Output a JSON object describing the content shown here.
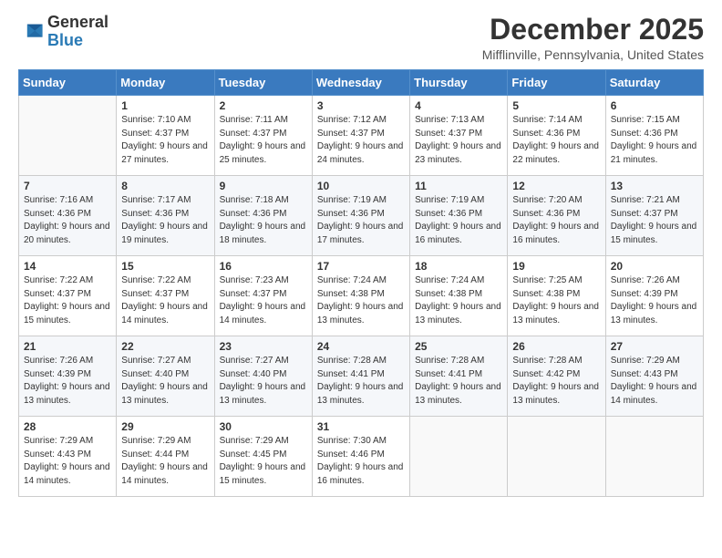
{
  "header": {
    "logo": {
      "line1": "General",
      "line2": "Blue"
    },
    "title": "December 2025",
    "location": "Mifflinville, Pennsylvania, United States"
  },
  "days_of_week": [
    "Sunday",
    "Monday",
    "Tuesday",
    "Wednesday",
    "Thursday",
    "Friday",
    "Saturday"
  ],
  "weeks": [
    [
      {
        "day": "",
        "sunrise": "",
        "sunset": "",
        "daylight": ""
      },
      {
        "day": "1",
        "sunrise": "Sunrise: 7:10 AM",
        "sunset": "Sunset: 4:37 PM",
        "daylight": "Daylight: 9 hours and 27 minutes."
      },
      {
        "day": "2",
        "sunrise": "Sunrise: 7:11 AM",
        "sunset": "Sunset: 4:37 PM",
        "daylight": "Daylight: 9 hours and 25 minutes."
      },
      {
        "day": "3",
        "sunrise": "Sunrise: 7:12 AM",
        "sunset": "Sunset: 4:37 PM",
        "daylight": "Daylight: 9 hours and 24 minutes."
      },
      {
        "day": "4",
        "sunrise": "Sunrise: 7:13 AM",
        "sunset": "Sunset: 4:37 PM",
        "daylight": "Daylight: 9 hours and 23 minutes."
      },
      {
        "day": "5",
        "sunrise": "Sunrise: 7:14 AM",
        "sunset": "Sunset: 4:36 PM",
        "daylight": "Daylight: 9 hours and 22 minutes."
      },
      {
        "day": "6",
        "sunrise": "Sunrise: 7:15 AM",
        "sunset": "Sunset: 4:36 PM",
        "daylight": "Daylight: 9 hours and 21 minutes."
      }
    ],
    [
      {
        "day": "7",
        "sunrise": "Sunrise: 7:16 AM",
        "sunset": "Sunset: 4:36 PM",
        "daylight": "Daylight: 9 hours and 20 minutes."
      },
      {
        "day": "8",
        "sunrise": "Sunrise: 7:17 AM",
        "sunset": "Sunset: 4:36 PM",
        "daylight": "Daylight: 9 hours and 19 minutes."
      },
      {
        "day": "9",
        "sunrise": "Sunrise: 7:18 AM",
        "sunset": "Sunset: 4:36 PM",
        "daylight": "Daylight: 9 hours and 18 minutes."
      },
      {
        "day": "10",
        "sunrise": "Sunrise: 7:19 AM",
        "sunset": "Sunset: 4:36 PM",
        "daylight": "Daylight: 9 hours and 17 minutes."
      },
      {
        "day": "11",
        "sunrise": "Sunrise: 7:19 AM",
        "sunset": "Sunset: 4:36 PM",
        "daylight": "Daylight: 9 hours and 16 minutes."
      },
      {
        "day": "12",
        "sunrise": "Sunrise: 7:20 AM",
        "sunset": "Sunset: 4:36 PM",
        "daylight": "Daylight: 9 hours and 16 minutes."
      },
      {
        "day": "13",
        "sunrise": "Sunrise: 7:21 AM",
        "sunset": "Sunset: 4:37 PM",
        "daylight": "Daylight: 9 hours and 15 minutes."
      }
    ],
    [
      {
        "day": "14",
        "sunrise": "Sunrise: 7:22 AM",
        "sunset": "Sunset: 4:37 PM",
        "daylight": "Daylight: 9 hours and 15 minutes."
      },
      {
        "day": "15",
        "sunrise": "Sunrise: 7:22 AM",
        "sunset": "Sunset: 4:37 PM",
        "daylight": "Daylight: 9 hours and 14 minutes."
      },
      {
        "day": "16",
        "sunrise": "Sunrise: 7:23 AM",
        "sunset": "Sunset: 4:37 PM",
        "daylight": "Daylight: 9 hours and 14 minutes."
      },
      {
        "day": "17",
        "sunrise": "Sunrise: 7:24 AM",
        "sunset": "Sunset: 4:38 PM",
        "daylight": "Daylight: 9 hours and 13 minutes."
      },
      {
        "day": "18",
        "sunrise": "Sunrise: 7:24 AM",
        "sunset": "Sunset: 4:38 PM",
        "daylight": "Daylight: 9 hours and 13 minutes."
      },
      {
        "day": "19",
        "sunrise": "Sunrise: 7:25 AM",
        "sunset": "Sunset: 4:38 PM",
        "daylight": "Daylight: 9 hours and 13 minutes."
      },
      {
        "day": "20",
        "sunrise": "Sunrise: 7:26 AM",
        "sunset": "Sunset: 4:39 PM",
        "daylight": "Daylight: 9 hours and 13 minutes."
      }
    ],
    [
      {
        "day": "21",
        "sunrise": "Sunrise: 7:26 AM",
        "sunset": "Sunset: 4:39 PM",
        "daylight": "Daylight: 9 hours and 13 minutes."
      },
      {
        "day": "22",
        "sunrise": "Sunrise: 7:27 AM",
        "sunset": "Sunset: 4:40 PM",
        "daylight": "Daylight: 9 hours and 13 minutes."
      },
      {
        "day": "23",
        "sunrise": "Sunrise: 7:27 AM",
        "sunset": "Sunset: 4:40 PM",
        "daylight": "Daylight: 9 hours and 13 minutes."
      },
      {
        "day": "24",
        "sunrise": "Sunrise: 7:28 AM",
        "sunset": "Sunset: 4:41 PM",
        "daylight": "Daylight: 9 hours and 13 minutes."
      },
      {
        "day": "25",
        "sunrise": "Sunrise: 7:28 AM",
        "sunset": "Sunset: 4:41 PM",
        "daylight": "Daylight: 9 hours and 13 minutes."
      },
      {
        "day": "26",
        "sunrise": "Sunrise: 7:28 AM",
        "sunset": "Sunset: 4:42 PM",
        "daylight": "Daylight: 9 hours and 13 minutes."
      },
      {
        "day": "27",
        "sunrise": "Sunrise: 7:29 AM",
        "sunset": "Sunset: 4:43 PM",
        "daylight": "Daylight: 9 hours and 14 minutes."
      }
    ],
    [
      {
        "day": "28",
        "sunrise": "Sunrise: 7:29 AM",
        "sunset": "Sunset: 4:43 PM",
        "daylight": "Daylight: 9 hours and 14 minutes."
      },
      {
        "day": "29",
        "sunrise": "Sunrise: 7:29 AM",
        "sunset": "Sunset: 4:44 PM",
        "daylight": "Daylight: 9 hours and 14 minutes."
      },
      {
        "day": "30",
        "sunrise": "Sunrise: 7:29 AM",
        "sunset": "Sunset: 4:45 PM",
        "daylight": "Daylight: 9 hours and 15 minutes."
      },
      {
        "day": "31",
        "sunrise": "Sunrise: 7:30 AM",
        "sunset": "Sunset: 4:46 PM",
        "daylight": "Daylight: 9 hours and 16 minutes."
      },
      {
        "day": "",
        "sunrise": "",
        "sunset": "",
        "daylight": ""
      },
      {
        "day": "",
        "sunrise": "",
        "sunset": "",
        "daylight": ""
      },
      {
        "day": "",
        "sunrise": "",
        "sunset": "",
        "daylight": ""
      }
    ]
  ]
}
